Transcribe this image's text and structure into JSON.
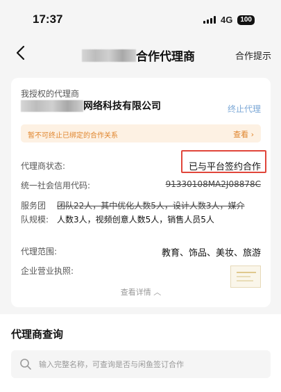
{
  "status_bar": {
    "time": "17:37",
    "network": "4G",
    "battery": "100"
  },
  "nav": {
    "title": "合作代理商",
    "right_action": "合作提示"
  },
  "agent_card": {
    "authorized_label": "我授权的代理商",
    "company_name": "网络科技有限公司",
    "terminate_label": "终止代理",
    "notice_text": "暂不可终止已绑定的合作关系",
    "notice_link": "查看 ›",
    "rows": {
      "status_label": "代理商状态:",
      "status_value": "已与平台签约合作",
      "credit_label": "统一社会信用代码:",
      "credit_value": "91330108MA2J08878C",
      "team_label": "服务团队规模:",
      "team_value_line1": "团队22人，其中优化人数5人，设计人数3人，媒介",
      "team_value_line2": "人数3人，视频创意人数5人，销售人员5人",
      "scope_label": "代理范围:",
      "scope_value": "教育、饰品、美妆、旅游",
      "license_label": "企业营业执照:"
    },
    "more_label": "查看详情 ︿"
  },
  "query": {
    "title": "代理商查询",
    "placeholder": "输入完整名称，可查询是否与闲鱼签订合作"
  }
}
